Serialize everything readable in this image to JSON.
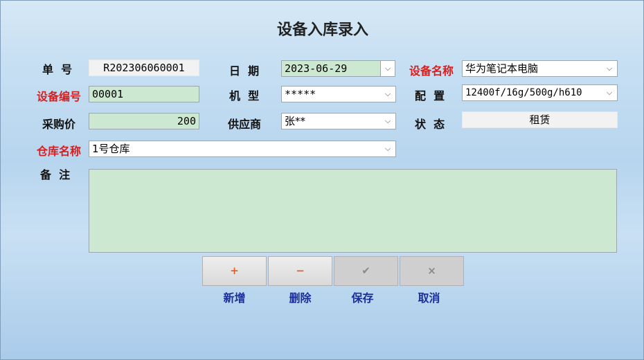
{
  "title": "设备入库录入",
  "labels": {
    "order_no": "单  号",
    "date": "日  期",
    "device_name": "设备名称",
    "device_code": "设备编号",
    "model": "机  型",
    "config": "配  置",
    "purchase_price": "采购价",
    "supplier": "供应商",
    "status": "状  态",
    "warehouse": "仓库名称",
    "remark": "备  注"
  },
  "values": {
    "order_no": "R202306060001",
    "date": "2023-06-29",
    "device_name": "华为笔记本电脑",
    "device_code": "00001",
    "model": "*****",
    "config": "12400f/16g/500g/h610",
    "purchase_price": "200",
    "supplier": "张**",
    "status": "租赁",
    "warehouse": "1号仓库",
    "remark": ""
  },
  "icons": {
    "dropdown": "chevron-down-icon",
    "add": "plus-icon",
    "delete": "minus-icon",
    "save": "check-icon",
    "cancel": "x-icon"
  },
  "buttons": {
    "add_symbol": "+",
    "delete_symbol": "−",
    "save_symbol": "✔",
    "cancel_symbol": "×",
    "add_label": "新增",
    "delete_label": "删除",
    "save_label": "保存",
    "cancel_label": "取消"
  },
  "colors": {
    "required_label": "#d81e1e",
    "field_green": "#cde8d0",
    "button_label": "#1a2e9c"
  }
}
